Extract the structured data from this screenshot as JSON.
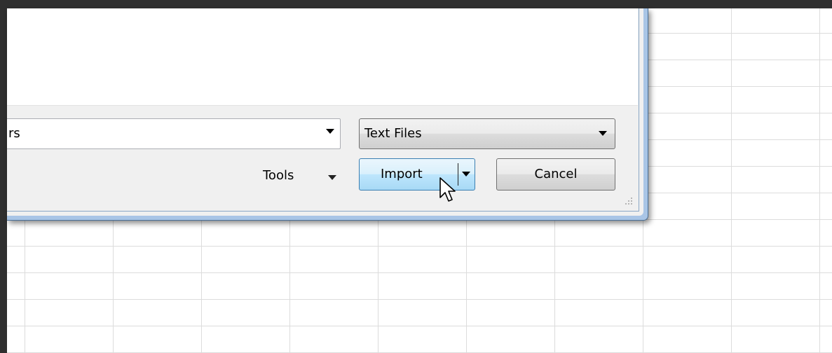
{
  "dialog": {
    "filename_value": "rs",
    "file_type": {
      "selected": "Text Files"
    },
    "tools_label": "Tools",
    "import_label": "Import",
    "cancel_label": "Cancel"
  },
  "icons": {
    "filename_dropdown": "triangle-down-icon",
    "filetype_dropdown": "triangle-down-icon",
    "tools_dropdown": "triangle-down-icon",
    "import_dropdown": "triangle-down-icon",
    "cursor": "mouse-pointer-icon",
    "resize": "resize-grip-icon"
  },
  "colors": {
    "hover_button": "#bee6fd",
    "dialog_border": "#4a6f96",
    "frame": "#2f2f2f"
  }
}
